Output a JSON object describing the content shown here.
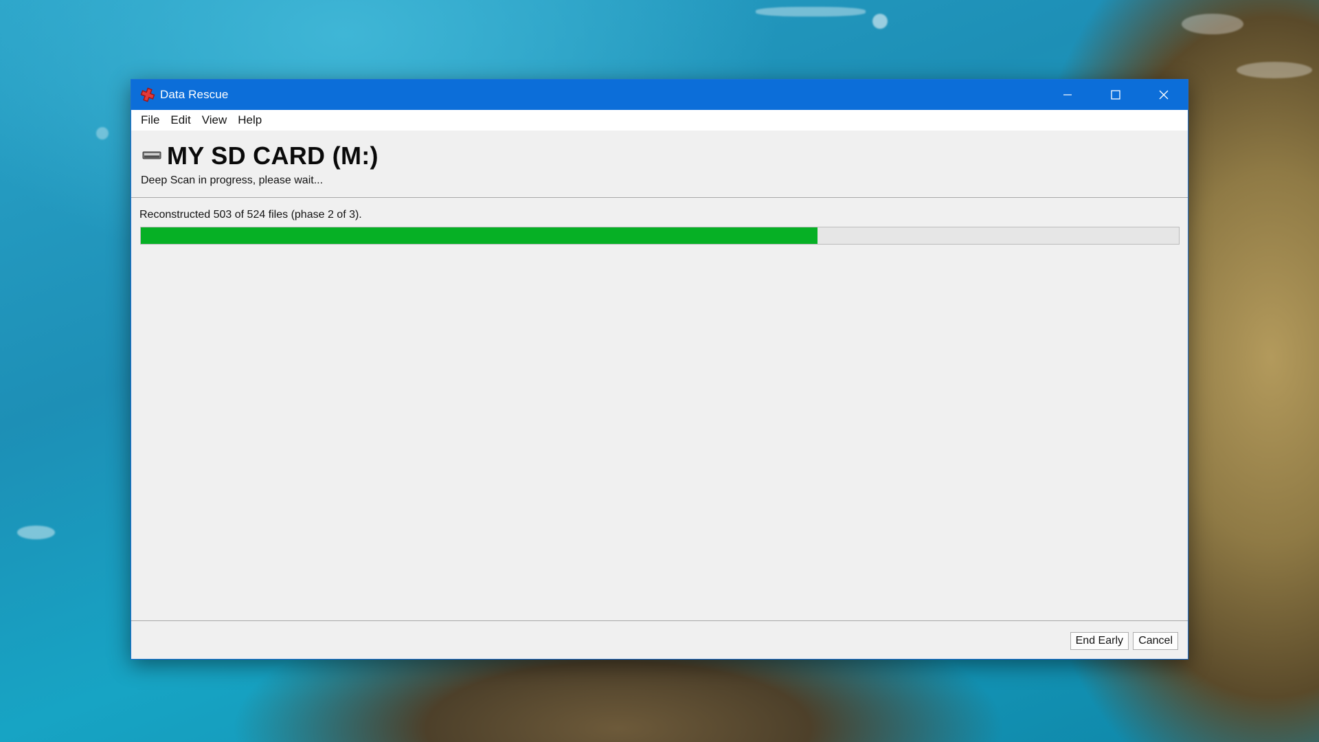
{
  "window": {
    "title": "Data Rescue",
    "controls": {
      "minimize_icon": "minimize-icon",
      "maximize_icon": "maximize-icon",
      "close_icon": "close-icon"
    },
    "titlebar_color": "#0c6ed9"
  },
  "menu": {
    "items": [
      "File",
      "Edit",
      "View",
      "Help"
    ]
  },
  "header": {
    "drive_icon": "drive-icon",
    "drive_name": "MY SD CARD (M:)",
    "status": "Deep Scan in progress, please wait..."
  },
  "progress": {
    "label": "Reconstructed 503 of 524 files (phase 2 of 3).",
    "fraction": 0.652,
    "fill_color": "#06b025"
  },
  "footer": {
    "end_early_label": "End Early",
    "cancel_label": "Cancel"
  }
}
